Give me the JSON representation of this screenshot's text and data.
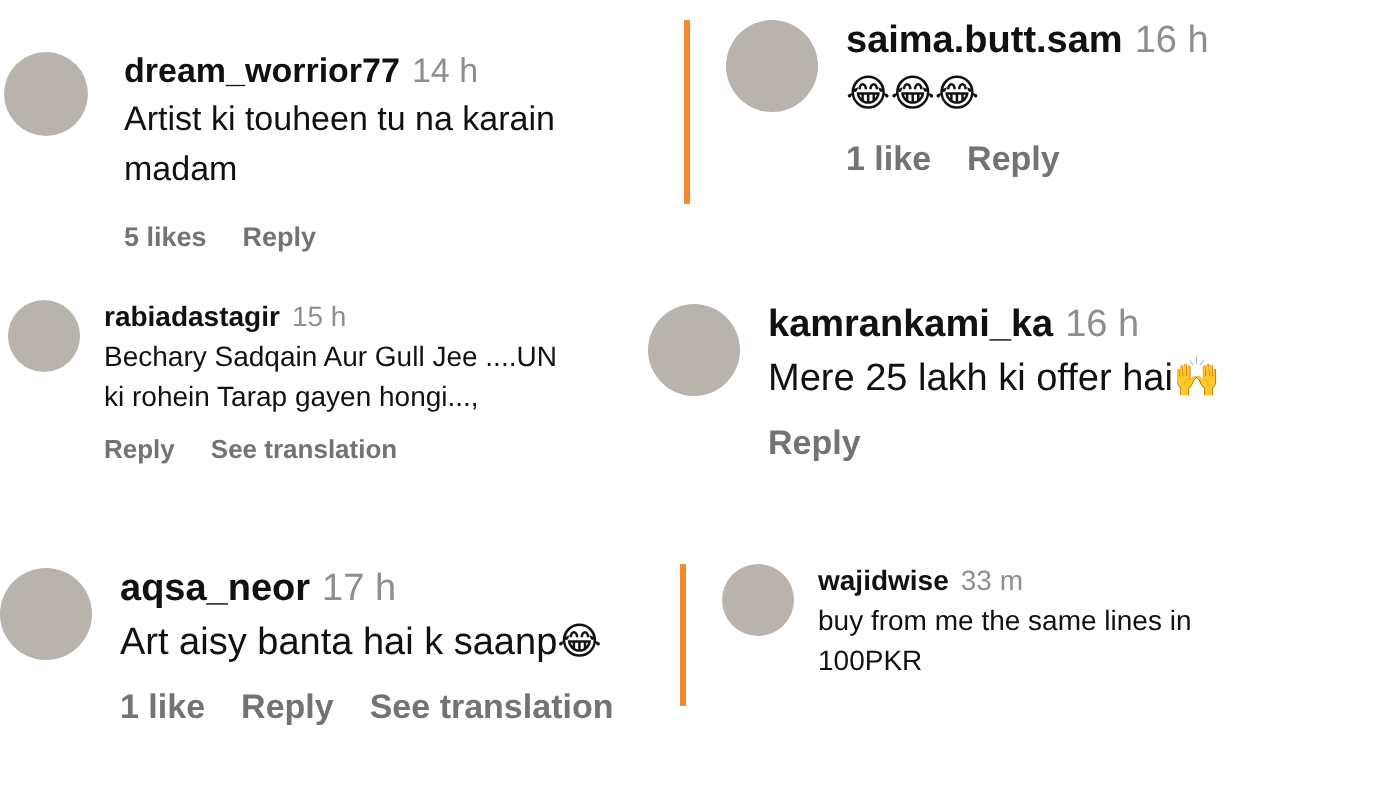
{
  "comments": [
    {
      "kind": "medium",
      "threaded": false,
      "username": "dream_worrior77",
      "time": "14 h",
      "text": "Artist ki touheen tu na karain madam",
      "actions": [
        "5 likes",
        "Reply"
      ]
    },
    {
      "kind": "large",
      "threaded": true,
      "username": "saima.butt.sam",
      "time": "16 h",
      "text": "😂😂😂",
      "actions": [
        "1 like",
        "Reply"
      ]
    },
    {
      "kind": "small",
      "threaded": false,
      "username": "rabiadastagir",
      "time": "15 h",
      "text": "Bechary Sadqain Aur Gull Jee ....UN ki rohein Tarap gayen hongi...,",
      "actions": [
        "Reply",
        "See translation"
      ]
    },
    {
      "kind": "large",
      "threaded": false,
      "username": "kamrankami_ka",
      "time": "16 h",
      "text": "Mere 25 lakh ki offer hai🙌",
      "actions": [
        "Reply"
      ]
    },
    {
      "kind": "large",
      "threaded": false,
      "username": "aqsa_neor",
      "time": "17 h",
      "text": "Art aisy banta hai k saanp😂",
      "actions": [
        "1 like",
        "Reply",
        "See translation"
      ]
    },
    {
      "kind": "small",
      "threaded": true,
      "username": "wajidwise",
      "time": "33 m",
      "text": "buy from me the same lines in 100PKR"
    }
  ]
}
